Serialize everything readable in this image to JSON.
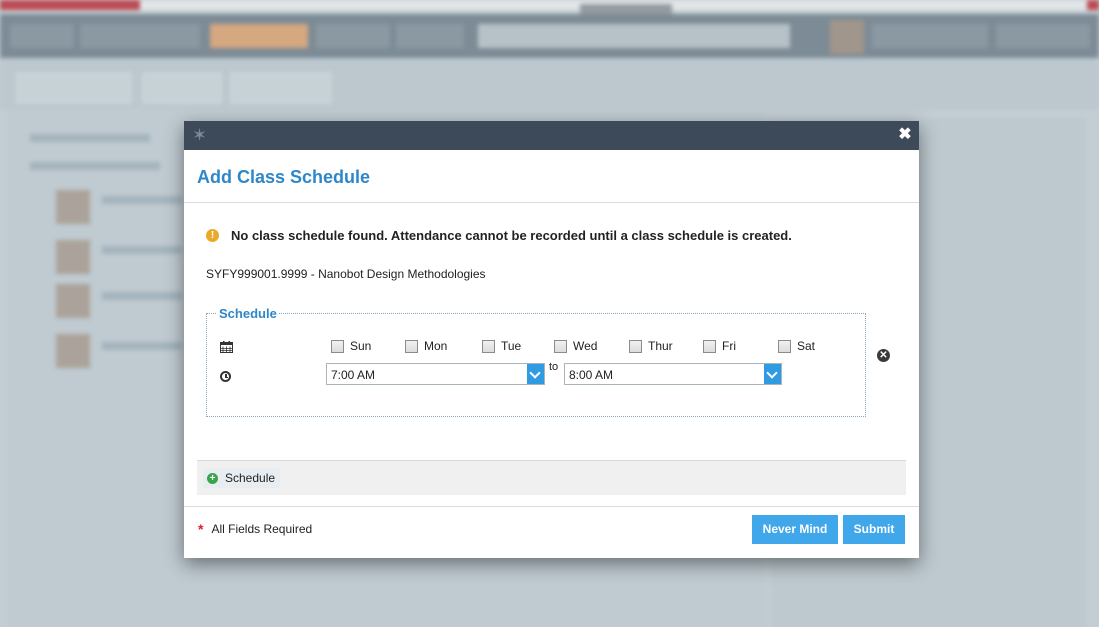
{
  "modal": {
    "title": "Add Class Schedule",
    "close_glyph": "✖",
    "logo_glyph": "✶",
    "warning_text": "No class schedule found. Attendance cannot be recorded until a class schedule is created.",
    "course_text": "SYFY999001.9999 - Nanobot Design Methodologies",
    "schedule": {
      "legend": "Schedule",
      "days": [
        {
          "label": "Sun",
          "checked": false
        },
        {
          "label": "Mon",
          "checked": false
        },
        {
          "label": "Tue",
          "checked": false
        },
        {
          "label": "Wed",
          "checked": false
        },
        {
          "label": "Thur",
          "checked": false
        },
        {
          "label": "Fri",
          "checked": false
        },
        {
          "label": "Sat",
          "checked": false
        }
      ],
      "start_time": "7:00 AM",
      "to_label": "to",
      "end_time": "8:00 AM"
    },
    "add_schedule_label": "Schedule",
    "required_note": "All Fields Required",
    "never_mind_label": "Never Mind",
    "submit_label": "Submit"
  },
  "colors": {
    "accent": "#2e87c8",
    "button": "#3fa7ea",
    "header": "#3c4a59",
    "warning": "#e9a92b",
    "required": "#d8232a",
    "add": "#3aa44a"
  },
  "icons": {
    "warning": "warning-icon",
    "calendar": "calendar-icon",
    "clock": "clock-icon",
    "remove": "remove-icon",
    "add": "plus-icon",
    "close": "close-icon"
  }
}
